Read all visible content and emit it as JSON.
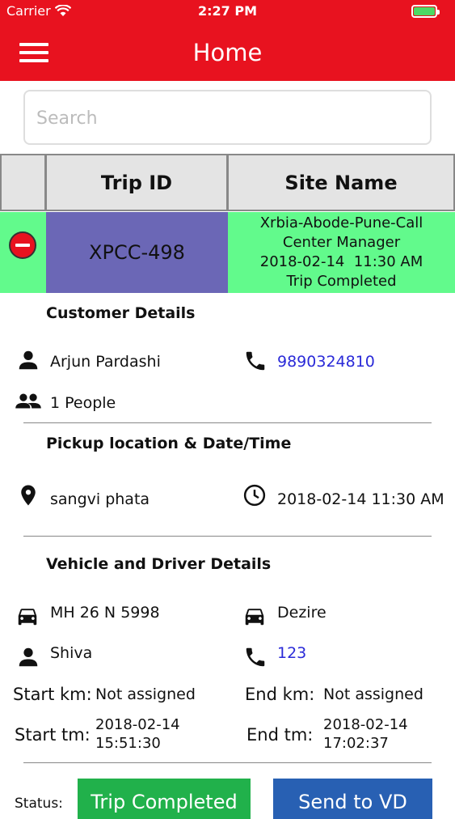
{
  "status_bar": {
    "carrier": "Carrier",
    "time": "2:27 PM"
  },
  "nav": {
    "title": "Home",
    "menu_icon": "hamburger-menu-icon"
  },
  "search": {
    "placeholder": "Search",
    "value": ""
  },
  "table": {
    "headers": [
      "",
      "Trip ID",
      "Site Name"
    ],
    "row": {
      "trip_id": "XPCC-498",
      "site_name_lines": [
        "Xrbia-Abode-Pune-Call",
        "Center Manager",
        "2018-02-14  11:30 AM",
        "Trip Completed"
      ],
      "row_color": "#62fa8c",
      "trip_id_color": "#6b67b6"
    }
  },
  "customer": {
    "title": "Customer Details",
    "name": "Arjun Pardashi",
    "phone": "9890324810",
    "people": "1 People"
  },
  "pickup": {
    "title": "Pickup location & Date/Time",
    "location": "sangvi phata",
    "datetime": "2018-02-14 11:30 AM"
  },
  "vehicle": {
    "title": "Vehicle and Driver Details",
    "number": "MH 26 N 5998",
    "model": "Dezire",
    "driver": "Shiva",
    "driver_phone": "123",
    "start_km_label": "Start km:",
    "start_km": "Not assigned",
    "end_km_label": "End km:",
    "end_km": "Not assigned",
    "start_tm_label": "Start tm:",
    "start_tm_date": "2018-02-14",
    "start_tm_time": "15:51:30",
    "end_tm_label": "End tm:",
    "end_tm_date": "2018-02-14",
    "end_tm_time": "17:02:37"
  },
  "footer": {
    "status_label": "Status:",
    "status_button": "Trip Completed",
    "send_button": "Send to VD"
  },
  "colors": {
    "accent": "#e8121f",
    "status_green": "#21b14b",
    "send_blue": "#2860b3",
    "link": "#2a2ad8"
  }
}
